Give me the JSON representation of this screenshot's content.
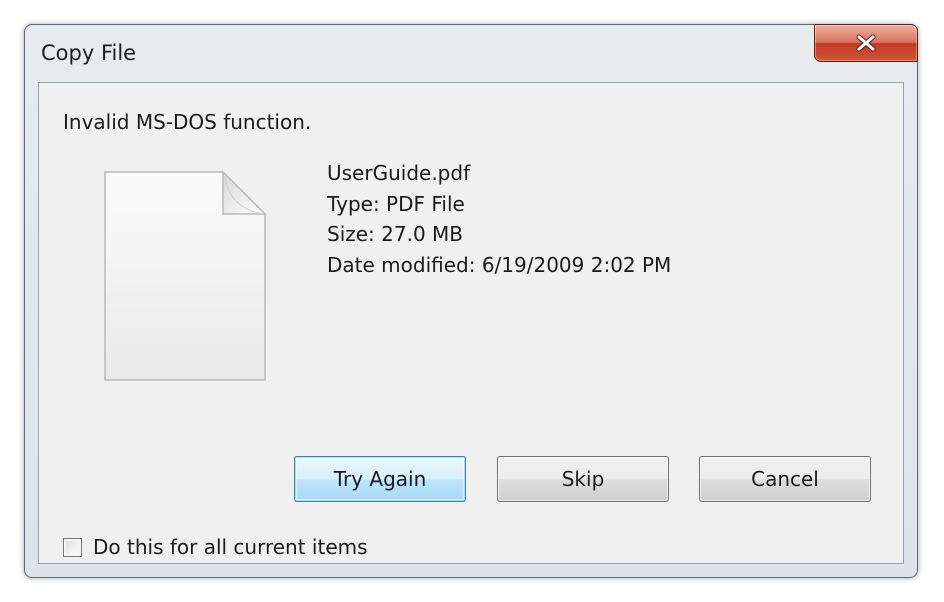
{
  "dialog": {
    "title": "Copy File",
    "message": "Invalid MS-DOS function.",
    "close_icon": "close-x-icon",
    "file_icon": "document-file-icon"
  },
  "file": {
    "name": "UserGuide.pdf",
    "type": "Type: PDF File",
    "size": "Size: 27.0 MB",
    "date_modified": "Date modified: 6/19/2009 2:02 PM"
  },
  "buttons": {
    "try_again": "Try Again",
    "skip": "Skip",
    "cancel": "Cancel"
  },
  "checkbox": {
    "label": "Do this for all current items",
    "checked": false
  },
  "colors": {
    "close_button": "#c13a20",
    "default_button": "#3c7fb1"
  }
}
